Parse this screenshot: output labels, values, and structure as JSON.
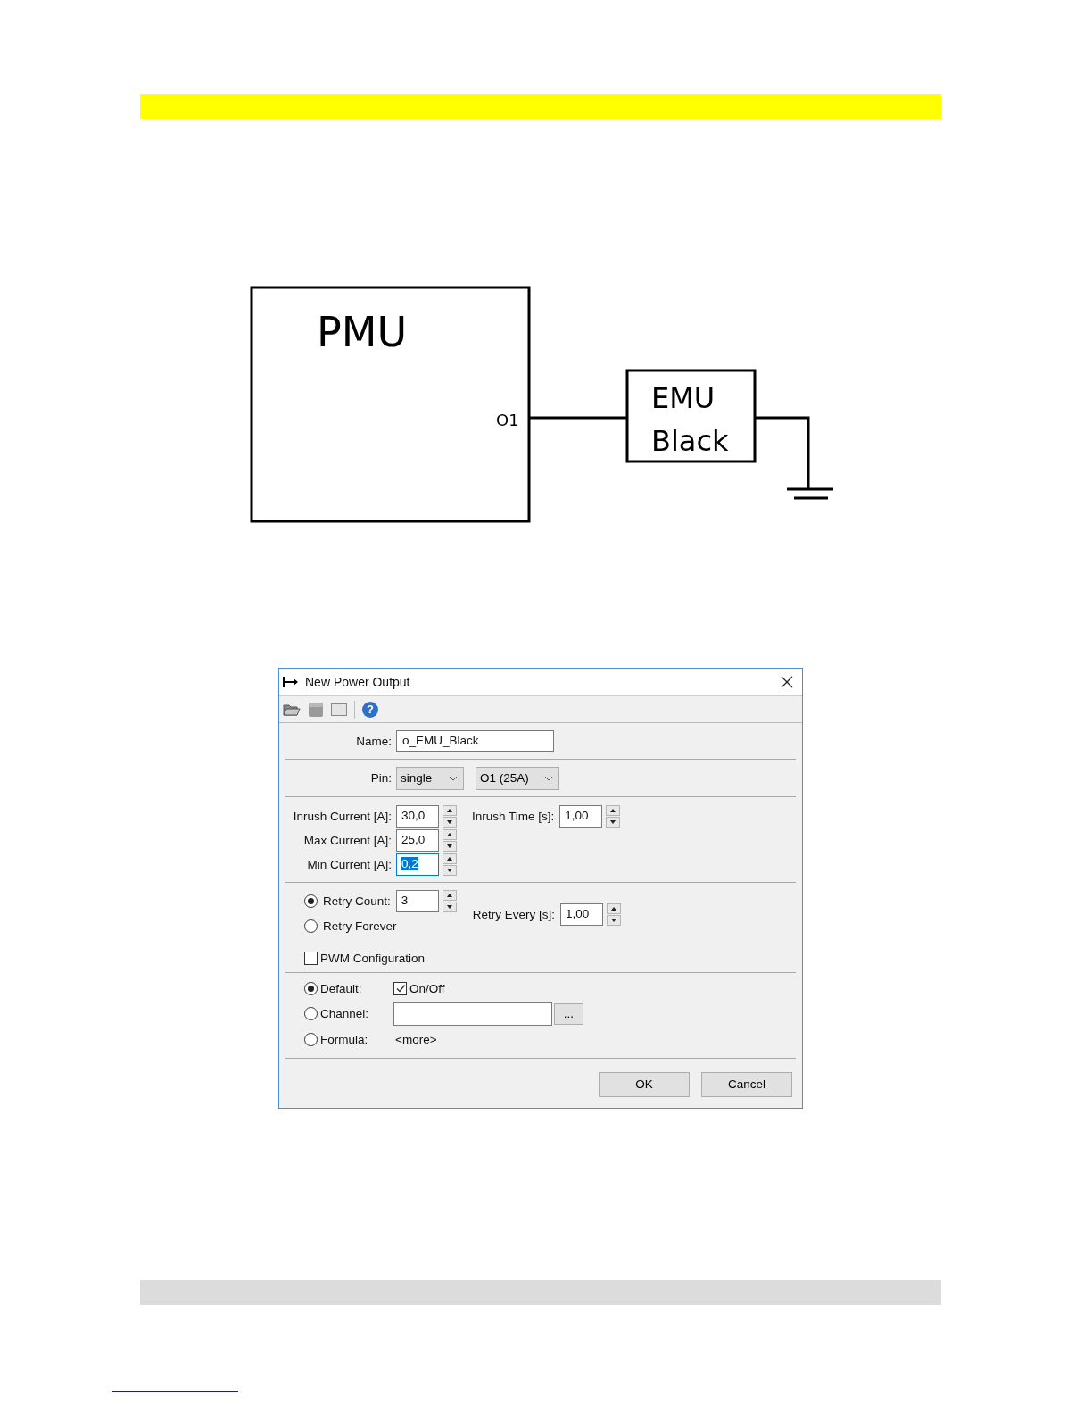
{
  "diagram": {
    "main_block": "PMU",
    "pin_label": "O1",
    "load_label_lines": [
      "EMU",
      "Black"
    ]
  },
  "dialog": {
    "title": "New Power Output",
    "toolbar": {
      "help_label": "?"
    },
    "name": {
      "label": "Name:",
      "value": "o_EMU_Black"
    },
    "pin": {
      "label": "Pin:",
      "mode": "single",
      "output": "O1 (25A)"
    },
    "currents": [
      {
        "label": "Inrush Current [A]:",
        "value": "30,0",
        "selected": false
      },
      {
        "label": "Max Current [A]:",
        "value": "25,0",
        "selected": false
      },
      {
        "label": "Min Current [A]:",
        "value": "0,2",
        "selected": true
      }
    ],
    "inrush_time": {
      "label": "Inrush Time [s]:",
      "value": "1,00"
    },
    "retry_options": [
      {
        "label": "Retry Count:",
        "selected": true
      },
      {
        "label": "Retry Forever",
        "selected": false
      }
    ],
    "retry_count": "3",
    "retry_every": {
      "label": "Retry Every [s]:",
      "value": "1,00"
    },
    "pwm": {
      "label": "PWM Configuration",
      "checked": false
    },
    "source_options": [
      {
        "kind": "default",
        "label": "Default:",
        "selected": true
      },
      {
        "kind": "channel",
        "label": "Channel:",
        "selected": false
      },
      {
        "kind": "formula",
        "label": "Formula:",
        "selected": false
      }
    ],
    "on_off": {
      "label": "On/Off",
      "checked": true
    },
    "channel_button": "...",
    "formula_link": "<more>",
    "buttons": [
      "OK",
      "Cancel"
    ]
  }
}
